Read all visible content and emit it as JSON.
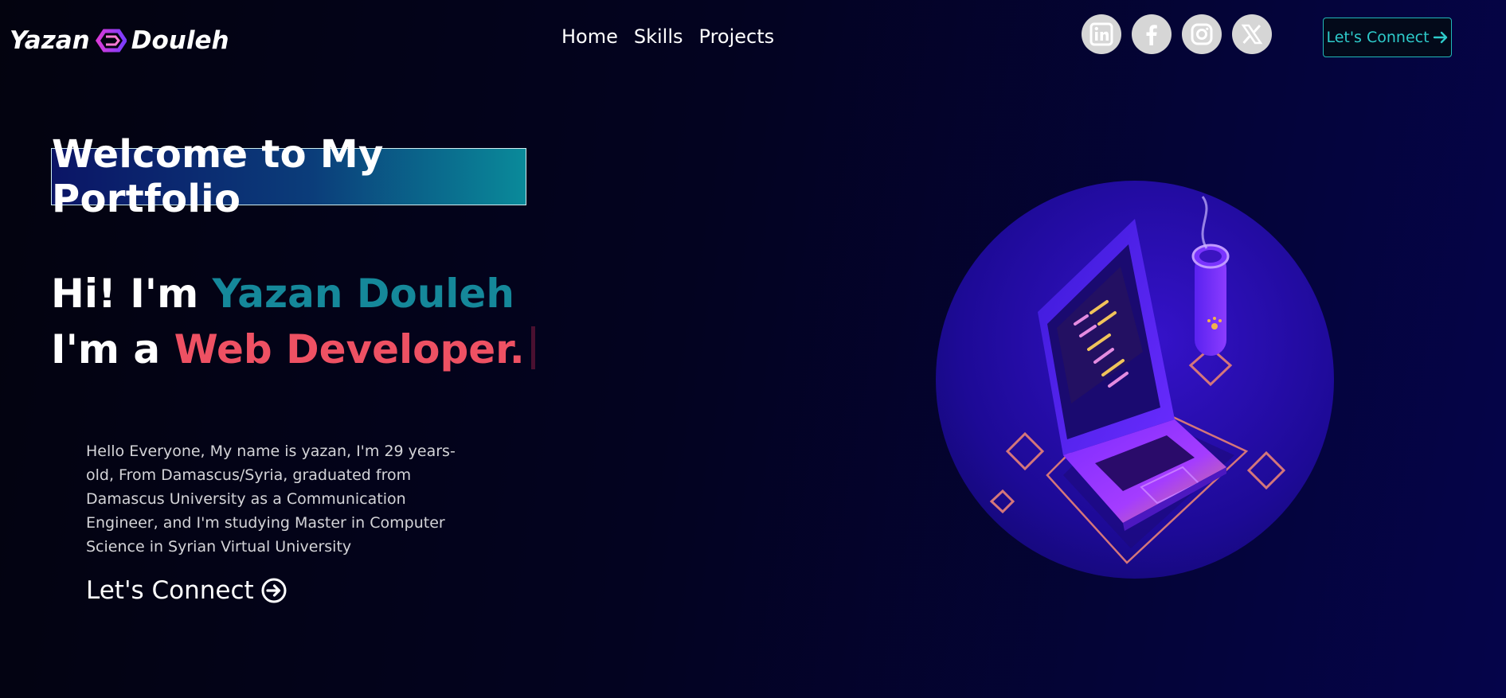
{
  "logo": {
    "first": "Yazan",
    "last": "Douleh",
    "icon": "hexagon-logo-icon"
  },
  "nav": {
    "items": [
      "Home",
      "Skills",
      "Projects"
    ]
  },
  "socials": [
    {
      "name": "linkedin-icon"
    },
    {
      "name": "facebook-icon"
    },
    {
      "name": "instagram-icon"
    },
    {
      "name": "x-icon"
    }
  ],
  "header_button": {
    "label": "Let's Connect",
    "icon": "arrow-right-icon"
  },
  "hero": {
    "welcome": "Welcome to My Portfolio",
    "greeting_prefix": "Hi! I'm",
    "name": "Yazan Douleh",
    "role_prefix": "I'm a",
    "role": "Web Developer.",
    "about": "Hello Everyone, My name is yazan, I'm 29 years-old, From Damascus/Syria, graduated from Damascus University as a Communication Engineer, and I'm studying Master in Computer Science in Syrian Virtual University",
    "connect_label": "Let's Connect",
    "connect_icon": "arrow-circle-right-icon"
  },
  "illustration": {
    "name": "laptop-illustration"
  },
  "colors": {
    "accent_teal": "#15889a",
    "accent_red": "#ee5163",
    "button_border": "#21b7b7",
    "illustration_circle": "#2a0eb8"
  }
}
